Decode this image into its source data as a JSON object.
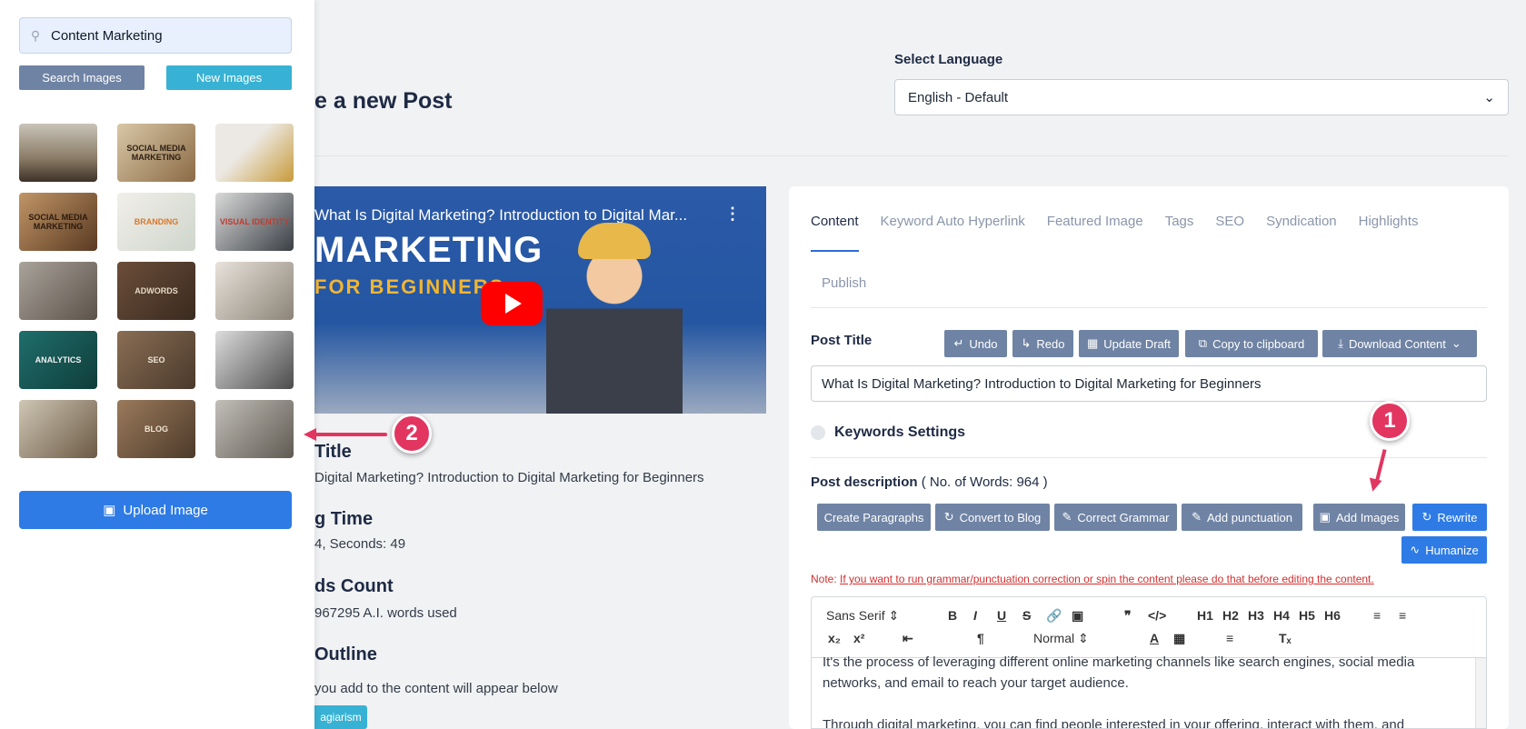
{
  "sidebar": {
    "search_value": "Content Marketing",
    "search_button": "Search Images",
    "new_button": "New Images",
    "upload_button": "Upload Image",
    "thumbnails": [
      {
        "label": ""
      },
      {
        "label": "SOCIAL MEDIA MARKETING"
      },
      {
        "label": ""
      },
      {
        "label": "SOCIAL MEDIA MARKETING"
      },
      {
        "label": "BRANDING"
      },
      {
        "label": "VISUAL IDENTITY"
      },
      {
        "label": ""
      },
      {
        "label": "ADWORDS"
      },
      {
        "label": ""
      },
      {
        "label": "ANALYTICS"
      },
      {
        "label": "SEO"
      },
      {
        "label": ""
      },
      {
        "label": ""
      },
      {
        "label": "BLOG"
      },
      {
        "label": ""
      }
    ]
  },
  "annotations": {
    "badge1": "1",
    "badge2": "2"
  },
  "header": {
    "page_title": "e a new Post",
    "language_label": "Select Language",
    "language_value": "English - Default"
  },
  "video": {
    "title": "What Is Digital Marketing? Introduction to Digital Mar...",
    "big_text_1": "MARKETING",
    "big_text_2": "FOR BEGINNERS"
  },
  "info": {
    "title_heading": "Title",
    "title_value": "Digital Marketing? Introduction to Digital Marketing for Beginners",
    "time_heading": "g Time",
    "time_value": "4, Seconds: 49",
    "words_heading": "ds Count",
    "words_value": "967295 A.I. words used",
    "outline_heading": "Outline",
    "outline_text": "you add to the content will appear below",
    "plagiarism_button": "agiarism"
  },
  "editor_card": {
    "tabs": [
      "Content",
      "Keyword Auto Hyperlink",
      "Featured Image",
      "Tags",
      "SEO",
      "Syndication",
      "Highlights"
    ],
    "tab_publish": "Publish",
    "post_title_label": "Post Title",
    "buttons": {
      "undo": "Undo",
      "redo": "Redo",
      "update_draft": "Update Draft",
      "copy": "Copy to clipboard",
      "download": "Download Content"
    },
    "post_title_value": "What Is Digital Marketing? Introduction to Digital Marketing for Beginners",
    "keywords_label": "Keywords Settings",
    "desc_label": "Post description",
    "desc_count": "( No. of Words: 964 )",
    "desc_buttons": {
      "create_paragraphs": "Create Paragraphs",
      "convert_blog": "Convert to Blog",
      "correct_grammar": "Correct Grammar",
      "add_punctuation": "Add punctuation",
      "add_images": "Add Images",
      "rewrite": "Rewrite",
      "humanize": "Humanize"
    },
    "note_prefix": "Note:",
    "note_text": "If you want to run grammar/punctuation correction or spin the content please do that before editing the content.",
    "toolbar": {
      "font": "Sans Serif",
      "size": "Normal"
    },
    "body_line1": "It's the process of leveraging different online marketing channels like search engines, social media",
    "body_line2": "networks, and email to reach your target audience.",
    "body_line3": "Through digital marketing, you can find people interested in your offering, interact with them, and"
  },
  "colors": {
    "accent_blue": "#2e7be6",
    "slate_button": "#6f83a4",
    "cyan_button": "#38b2d4",
    "annotation": "#e23560"
  }
}
